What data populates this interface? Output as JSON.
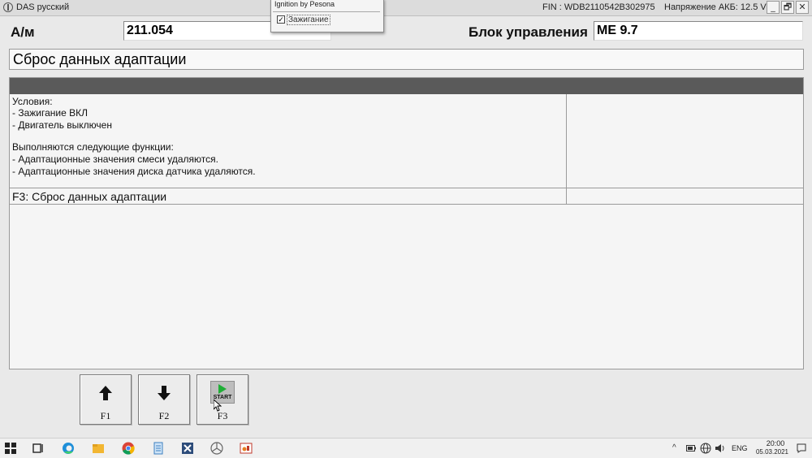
{
  "titlebar": {
    "app_title": "DAS русский",
    "fin": "FIN : WDB2110542B302975",
    "battery": "Напряжение АКБ: 12.5 V",
    "minimize": "_",
    "restore": "🗗",
    "close": "✕"
  },
  "popup": {
    "title": "Ignition by Pesona",
    "checkbox_label": "Зажигание",
    "checked": true,
    "check_mark": "✓"
  },
  "header": {
    "am_label": "А/м",
    "am_value": "211.054",
    "ecu_label": "Блок управления",
    "ecu_value": "ME 9.7"
  },
  "function_title": "Сброс данных адаптации",
  "panel": {
    "conditions_title": "Условия:",
    "conditions": [
      "- Зажигание ВКЛ",
      "- Двигатель выключен"
    ],
    "functions_title": "Выполняются следующие функции:",
    "functions": [
      "- Адаптационные значения смеси удаляются.",
      "- Адаптационные значения диска датчика удаляются."
    ],
    "f3_row": "F3: Сброс данных адаптации"
  },
  "fkeys": [
    {
      "label": "F1",
      "icon": "arrow-up-icon"
    },
    {
      "label": "F2",
      "icon": "arrow-down-icon"
    },
    {
      "label": "F3",
      "icon": "start-icon",
      "icon_text": "START"
    }
  ],
  "taskbar": {
    "lang": "ENG",
    "time": "20:00",
    "date": "05.03.2021",
    "icons": [
      "windows-start-icon",
      "task-view-icon",
      "edge-icon",
      "file-explorer-icon",
      "chrome-icon",
      "notepad-icon",
      "xentry-icon",
      "mercedes-icon",
      "paint-icon"
    ]
  },
  "colors": {
    "panel_header": "#5a5a5a",
    "start_play": "#1fae36"
  }
}
